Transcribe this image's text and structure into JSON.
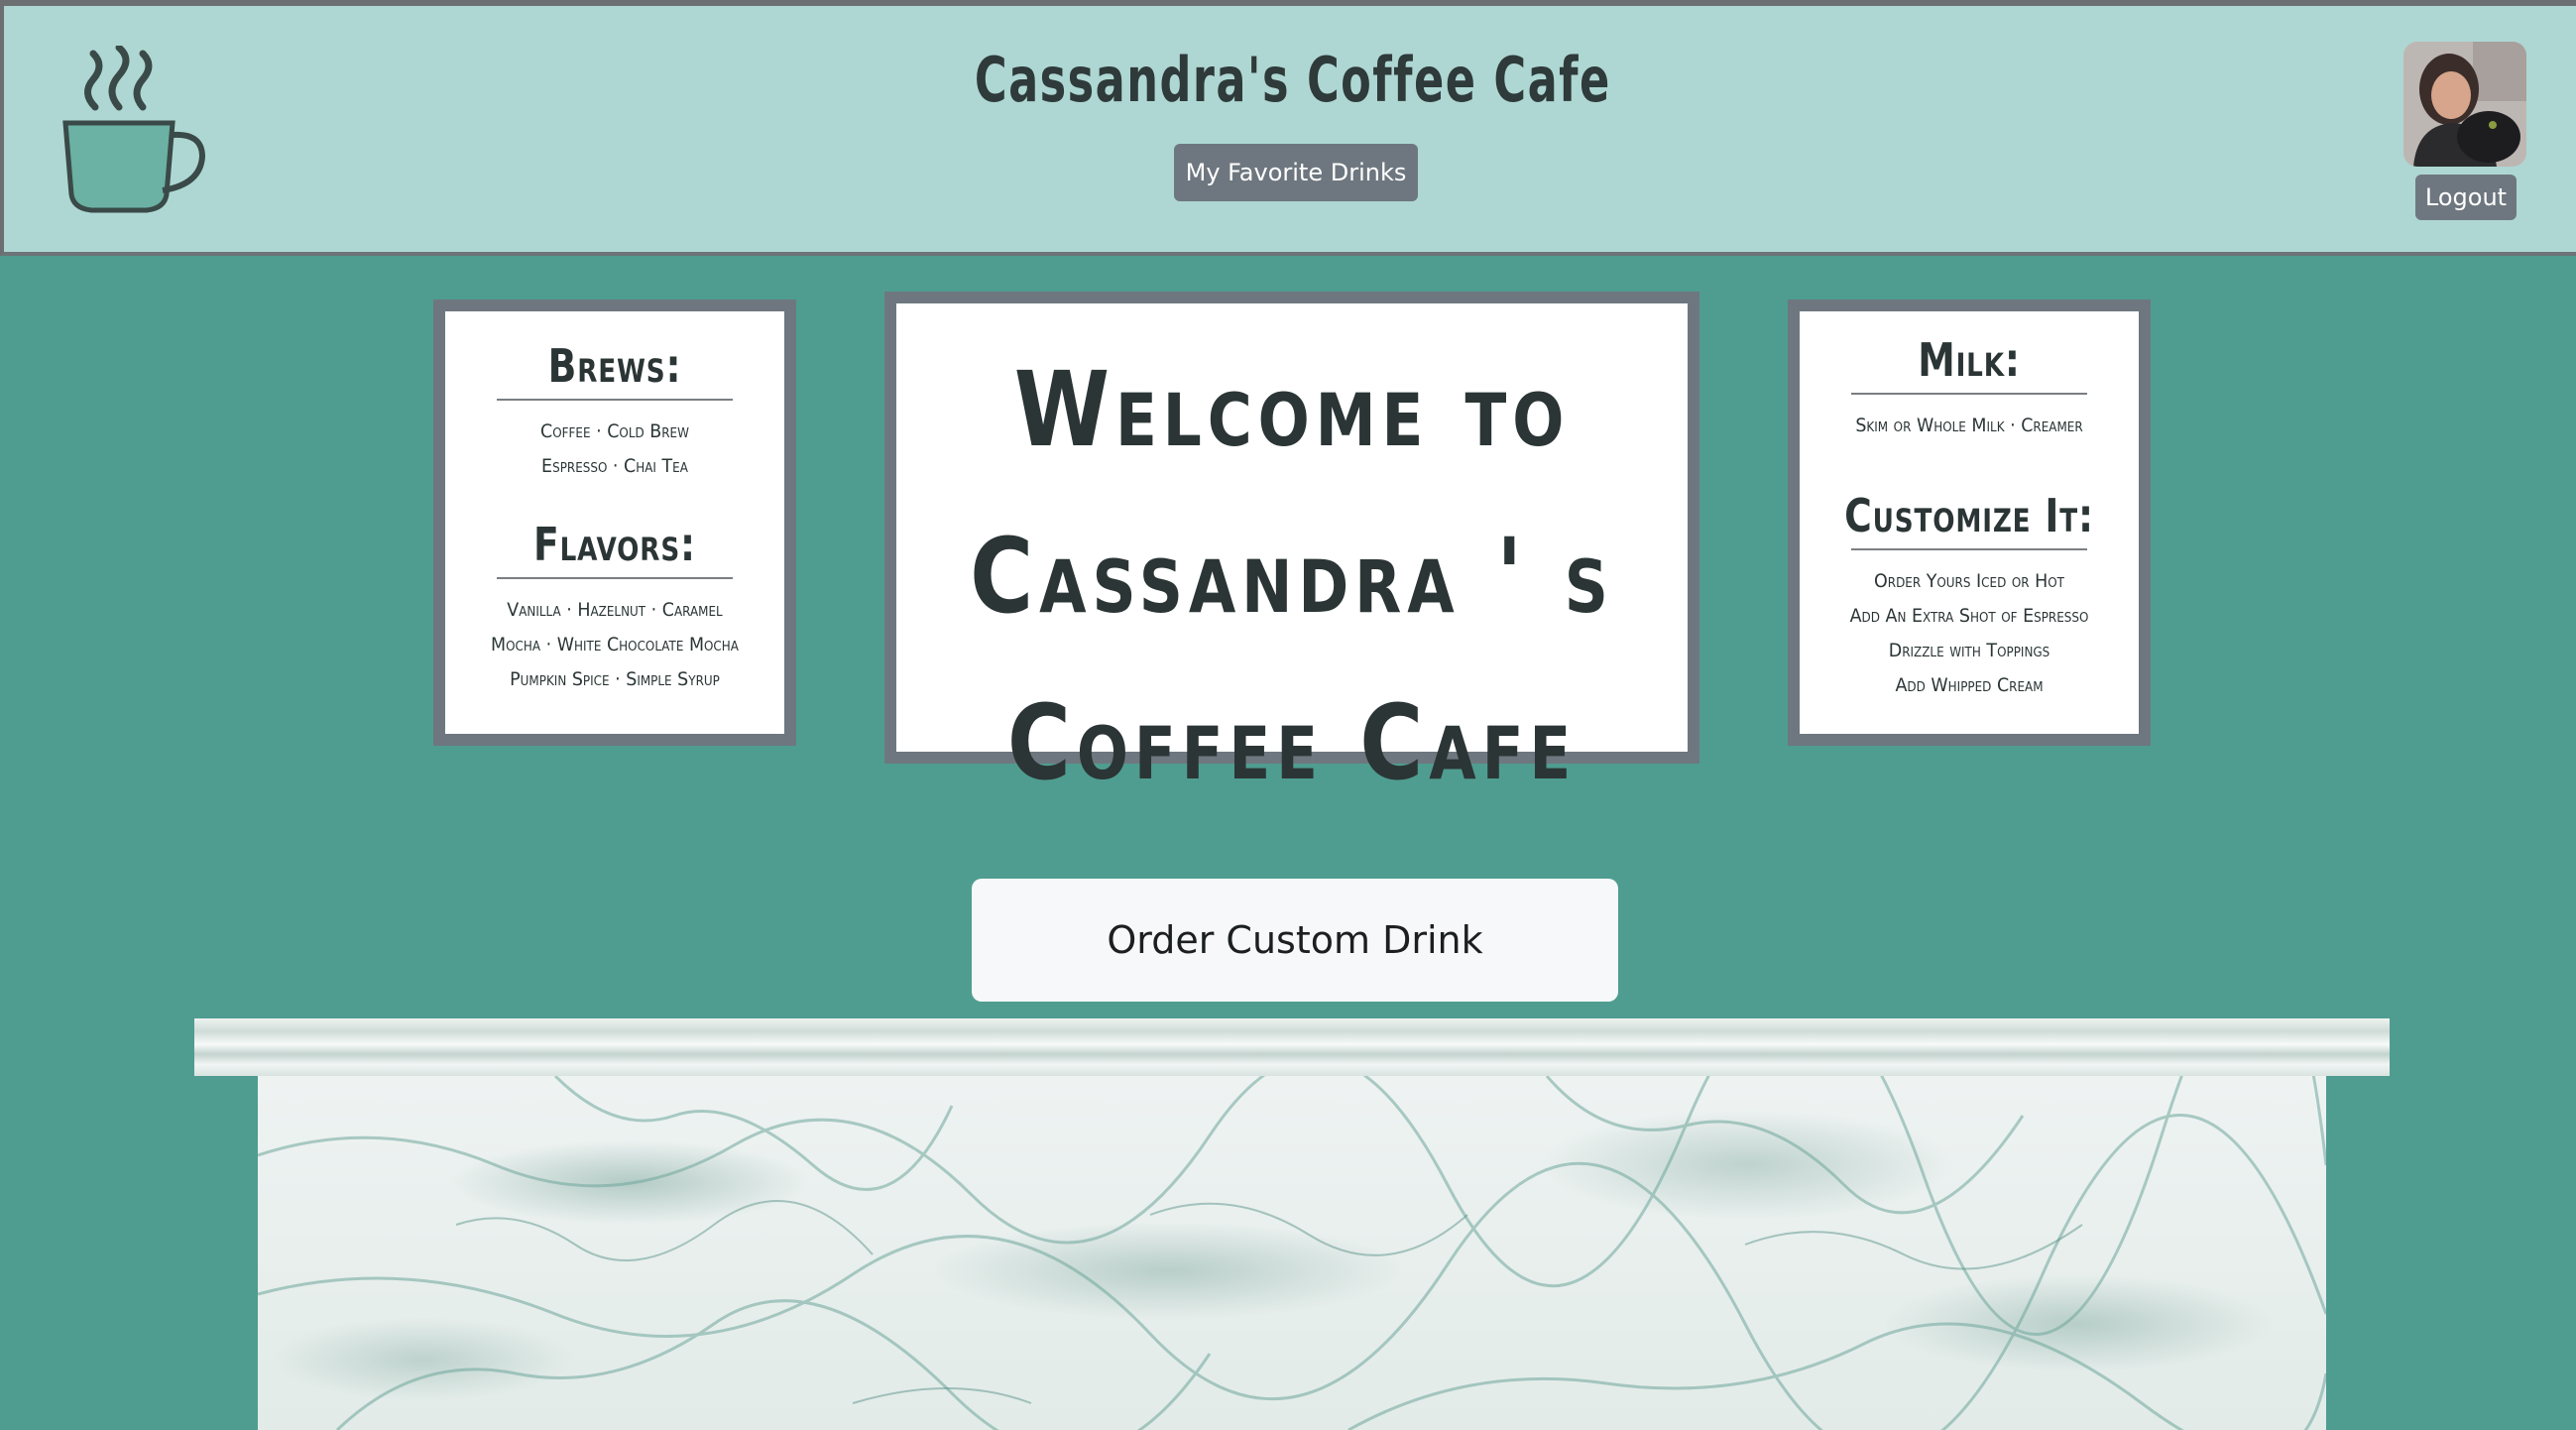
{
  "header": {
    "title": "Cassandra's Coffee Cafe",
    "favorites_label": "My Favorite Drinks",
    "logout_label": "Logout"
  },
  "boards": {
    "left": {
      "heading1": "Brews:",
      "brews": [
        "Coffee  ·  Cold Brew",
        "Espresso  ·  Chai Tea"
      ],
      "heading2": "Flavors:",
      "flavors": [
        "Vanilla · Hazelnut · Caramel",
        "Mocha · White Chocolate Mocha",
        "Pumpkin Spice · Simple Syrup"
      ]
    },
    "center": {
      "lines": [
        "Welcome to",
        "Cassandra ' s",
        "Coffee Cafe"
      ]
    },
    "right": {
      "heading1": "Milk:",
      "milk": "Skim or Whole Milk · Creamer",
      "heading2": "Customize It:",
      "options": [
        "Order Yours Iced or Hot",
        "Add An Extra Shot of Espresso",
        "Drizzle with Toppings",
        "Add Whipped Cream"
      ]
    }
  },
  "order_button_label": "Order Custom Drink",
  "icons": {
    "logo": "coffee-cup-icon",
    "avatar": "user-avatar"
  },
  "colors": {
    "background": "#4f9d90",
    "header": "#aed7d3",
    "button": "#6e777f",
    "board_frame": "#6e777f"
  }
}
